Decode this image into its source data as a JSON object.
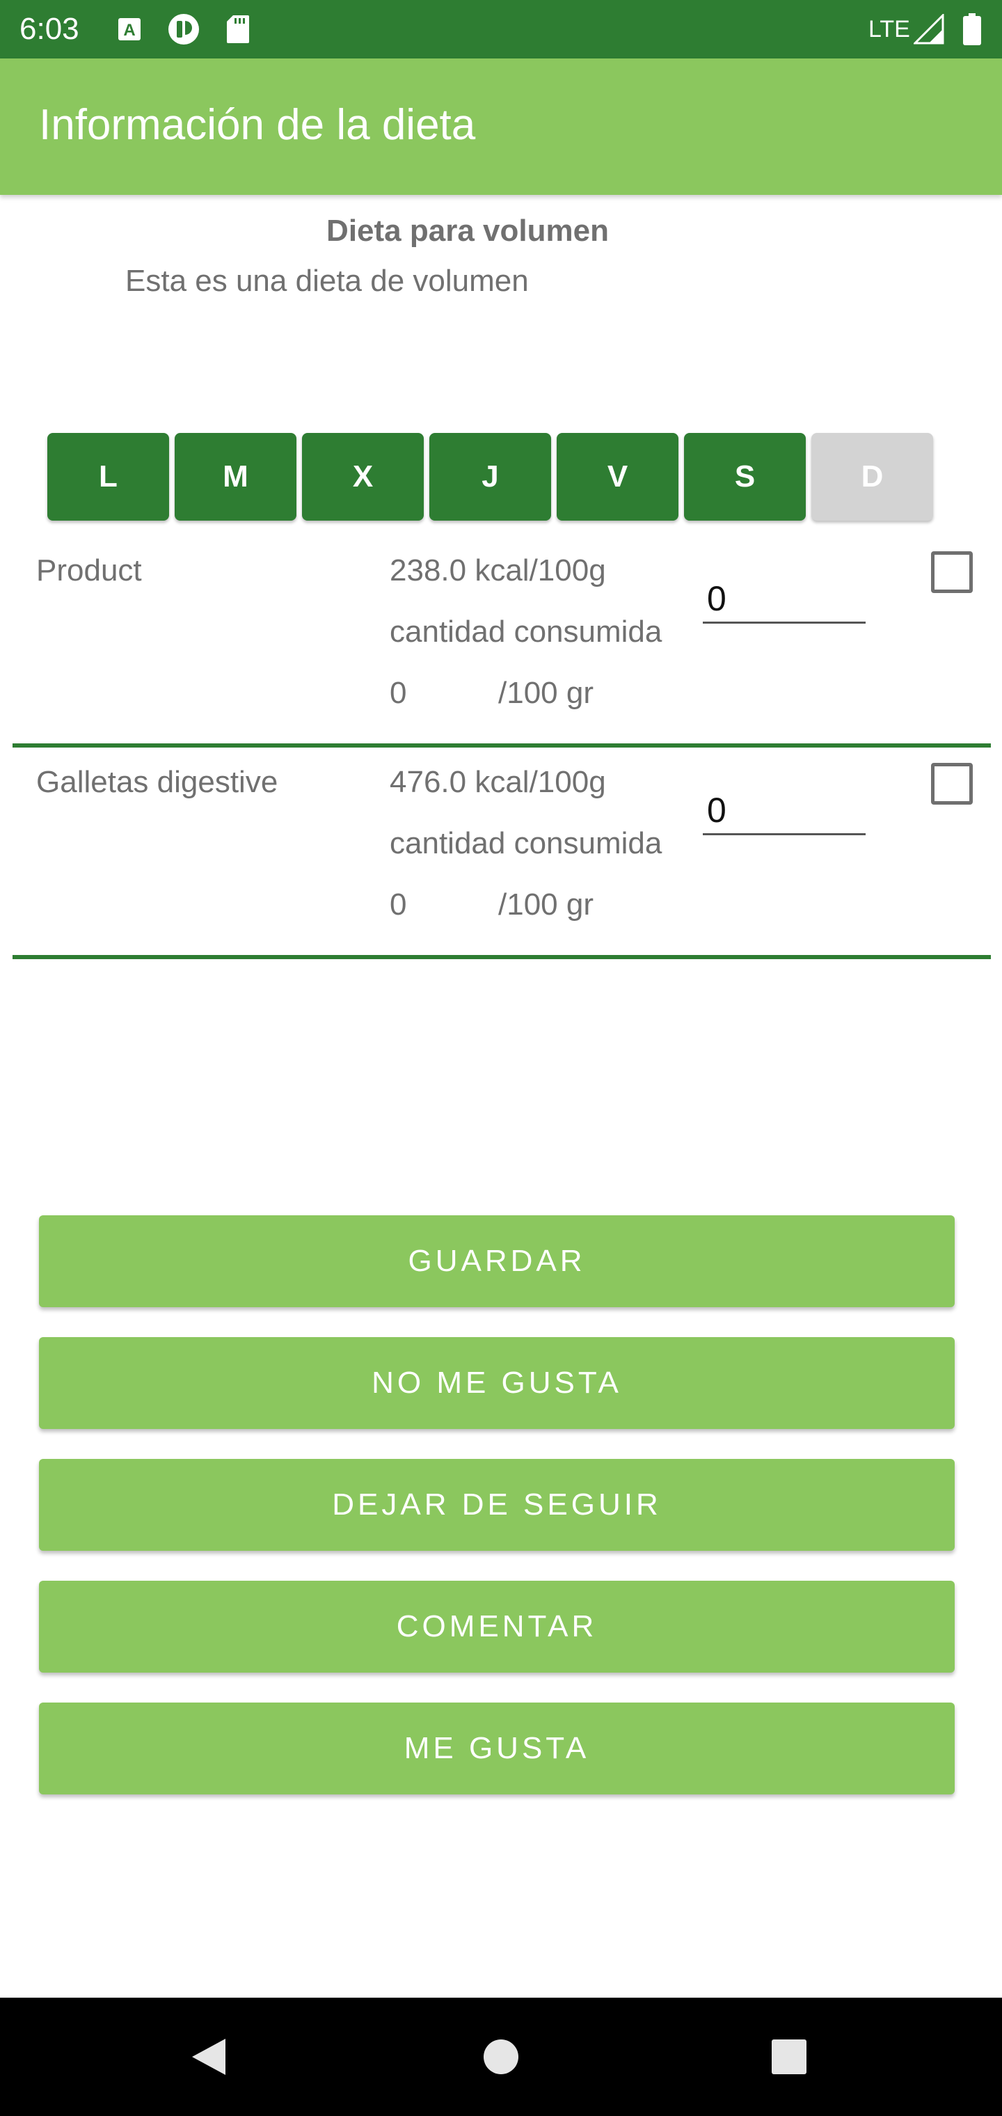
{
  "status_bar": {
    "time": "6:03",
    "network": "LTE",
    "icons": [
      "a-notification-icon",
      "play-protect-icon",
      "sd-card-icon",
      "signal-icon",
      "battery-icon"
    ]
  },
  "app_bar": {
    "title": "Información de la dieta"
  },
  "diet": {
    "name": "Dieta para volumen",
    "description": "Esta es una dieta de volumen"
  },
  "days": [
    {
      "label": "L",
      "active": true
    },
    {
      "label": "M",
      "active": true
    },
    {
      "label": "X",
      "active": true
    },
    {
      "label": "J",
      "active": true
    },
    {
      "label": "V",
      "active": true
    },
    {
      "label": "S",
      "active": true
    },
    {
      "label": "D",
      "active": false
    }
  ],
  "products": [
    {
      "name": "Product",
      "kcal": "238.0 kcal/100g",
      "consumed_label": "cantidad consumida",
      "consumed_value": "0",
      "unit": "/100 gr",
      "input_value": "0",
      "checked": false
    },
    {
      "name": "Galletas digestive",
      "kcal": "476.0 kcal/100g",
      "consumed_label": "cantidad consumida",
      "consumed_value": "0",
      "unit": "/100 gr",
      "input_value": "0",
      "checked": false
    }
  ],
  "actions": {
    "save": "GUARDAR",
    "dislike": "NO ME GUSTA",
    "unfollow": "DEJAR DE SEGUIR",
    "comment": "COMENTAR",
    "like": "ME GUSTA"
  },
  "colors": {
    "primary_dark": "#2e7d32",
    "primary": "#8bc75e",
    "inactive_day": "#d3d3d3",
    "text_gray": "#707070"
  }
}
